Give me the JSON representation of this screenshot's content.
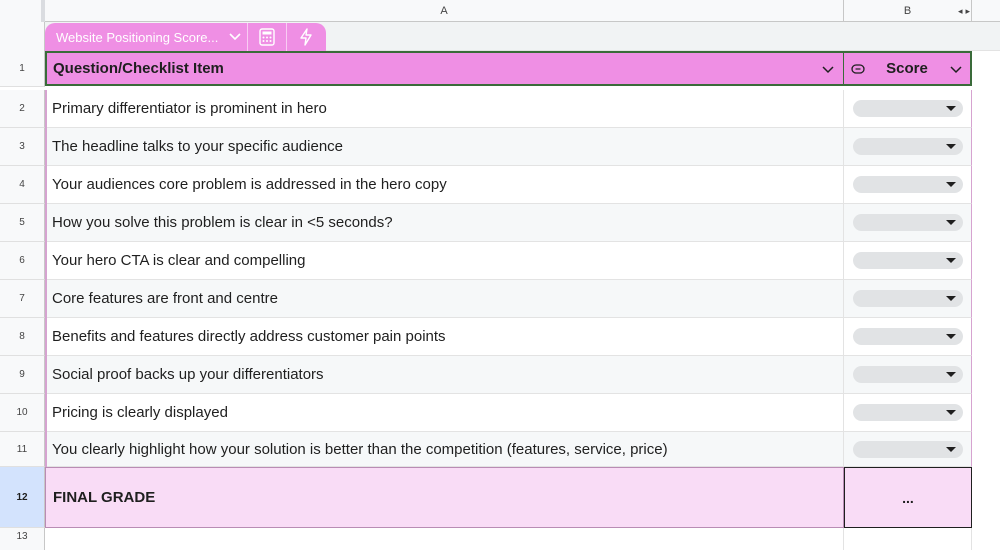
{
  "columns": {
    "a": "A",
    "b": "B"
  },
  "scroll_arrows": "◂▸",
  "table": {
    "name": "Website Positioning Score...",
    "chevron": "⌵",
    "icons": [
      "calculator-icon",
      "lightning-icon"
    ]
  },
  "header": {
    "row_number": "1",
    "question_label": "Question/Checklist Item",
    "score_label": "Score",
    "score_icon": "dropdown-chip-icon"
  },
  "rows": [
    {
      "num": "2",
      "text": "Primary differentiator is prominent in hero",
      "score": ""
    },
    {
      "num": "3",
      "text": "The headline talks to your specific audience",
      "score": ""
    },
    {
      "num": "4",
      "text": "Your audiences core problem is addressed in the hero copy",
      "score": ""
    },
    {
      "num": "5",
      "text": "How you solve this problem is clear in <5 seconds?",
      "score": ""
    },
    {
      "num": "6",
      "text": "Your hero CTA is clear and compelling",
      "score": ""
    },
    {
      "num": "7",
      "text": "Core features are front and centre",
      "score": ""
    },
    {
      "num": "8",
      "text": "Benefits and features directly address customer pain points",
      "score": ""
    },
    {
      "num": "9",
      "text": "Social proof backs up your differentiators",
      "score": ""
    },
    {
      "num": "10",
      "text": "Pricing is clearly displayed",
      "score": ""
    },
    {
      "num": "11",
      "text": "You clearly highlight how your solution is better than the competition (features, service, price)",
      "score": ""
    }
  ],
  "final": {
    "num": "12",
    "label": "FINAL GRADE",
    "value": "..."
  },
  "empty_row": {
    "num": "13"
  },
  "colors": {
    "accent": "#ef8fe4",
    "final_bg": "#f9dcf6",
    "header_border": "#3a6b3a",
    "selected_row": "#d3e3fd"
  }
}
